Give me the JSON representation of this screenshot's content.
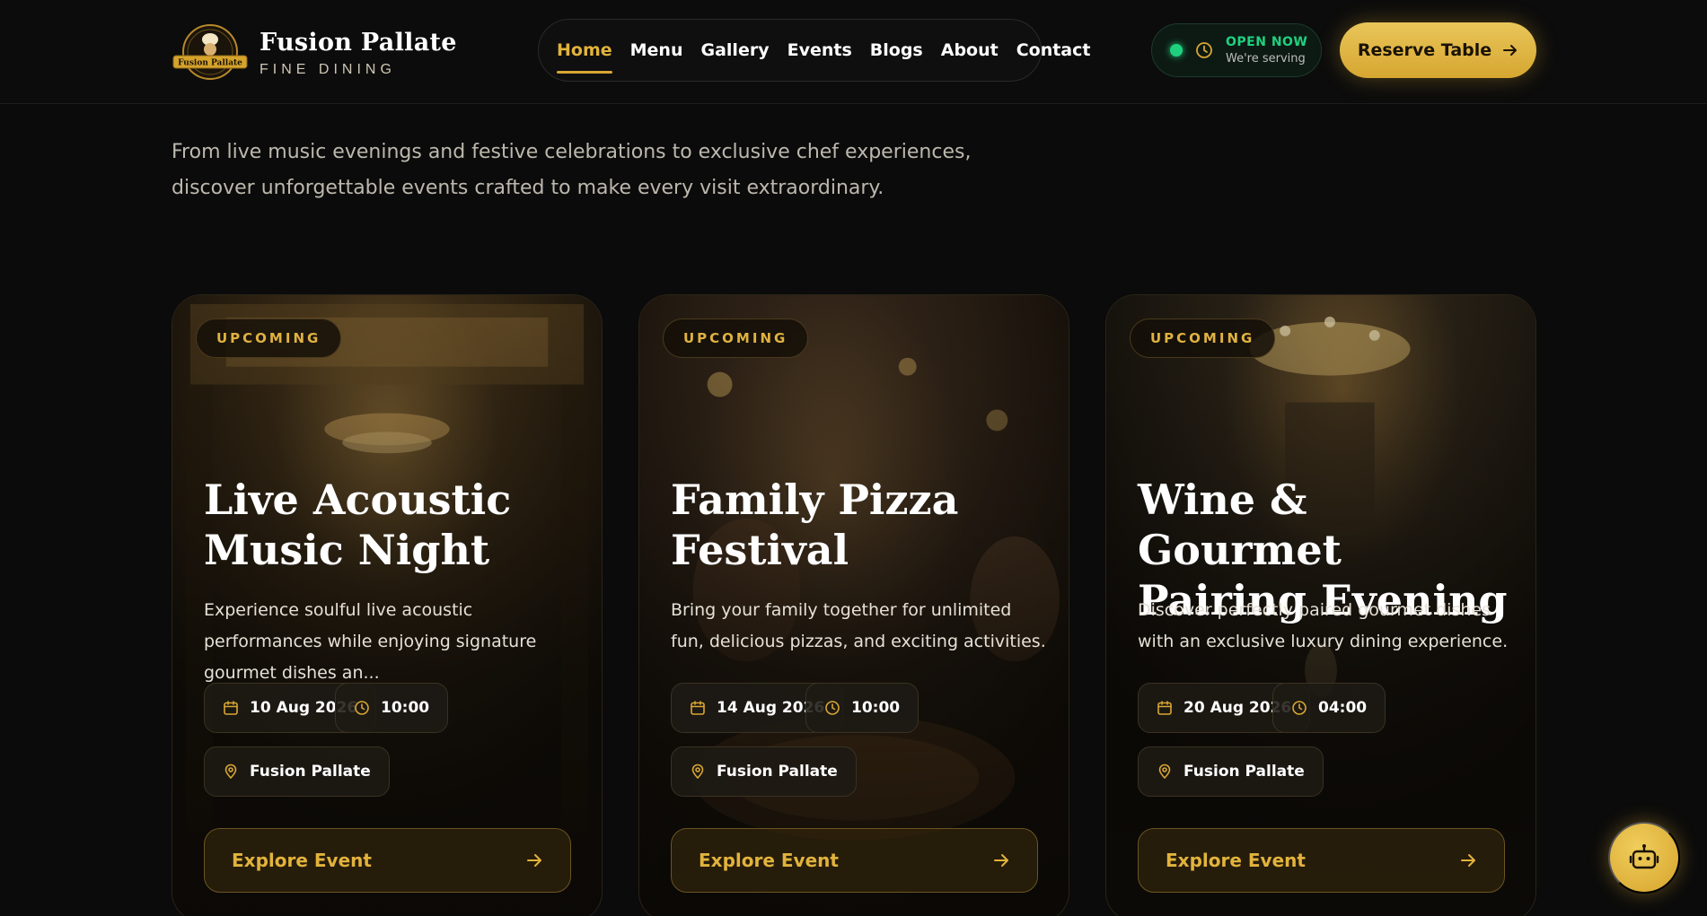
{
  "brand": {
    "name": "Fusion Pallate",
    "tagline": "FINE DINING",
    "logo_text": "Fusion Pallate",
    "logo_icon": "chef-emblem-icon"
  },
  "nav": {
    "items": [
      "Home",
      "Menu",
      "Gallery",
      "Events",
      "Blogs",
      "About",
      "Contact"
    ],
    "active": "Home"
  },
  "status": {
    "title": "OPEN NOW",
    "subtitle": "We're serving",
    "color": "#1fd17f"
  },
  "reserve": {
    "label": "Reserve Table",
    "icon": "arrow-right-icon"
  },
  "intro": {
    "line1": "From live music evenings and festive celebrations to exclusive chef experiences,",
    "line2": "discover unforgettable events crafted to make every visit extraordinary."
  },
  "events": [
    {
      "badge": "UPCOMING",
      "title_line1": "Live Acoustic",
      "title_line2": "Music Night",
      "description": "Experience soulful live acoustic performances while enjoying signature gourmet dishes an...",
      "date": "10 Aug 2026",
      "time": "10:00",
      "location": "Fusion Pallate",
      "cta": "Explore Event"
    },
    {
      "badge": "UPCOMING",
      "title_line1": "Family Pizza",
      "title_line2": "Festival",
      "description": "Bring your family together for unlimited fun, delicious pizzas, and exciting activities.",
      "date": "14 Aug 2026",
      "time": "10:00",
      "location": "Fusion Pallate",
      "cta": "Explore Event"
    },
    {
      "badge": "UPCOMING",
      "title_line1": "Wine & Gourmet",
      "title_line2": "Pairing Evening",
      "description": "Discover perfectly paired gourmet dishes with an exclusive luxury dining experience.",
      "date": "20 Aug 2026",
      "time": "04:00",
      "location": "Fusion Pallate",
      "cta": "Explore Event"
    }
  ],
  "assistant": {
    "icon": "robot-icon"
  },
  "colors": {
    "accent": "#e2b33c",
    "background": "#0b0b0b",
    "open": "#1fd17f"
  }
}
